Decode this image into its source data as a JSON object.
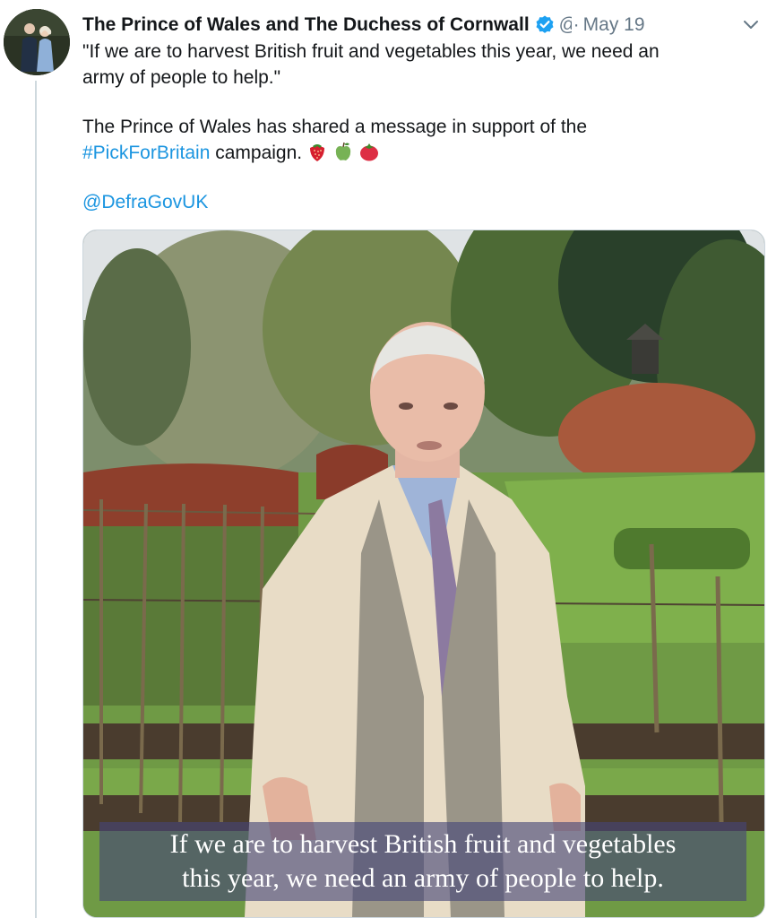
{
  "tweet": {
    "author": {
      "name": "The Prince of Wales and The Duchess of Cornwall",
      "verified": true,
      "handle": "@",
      "avatar_icon": "profile-photo"
    },
    "separator": "·",
    "date": "May 19",
    "menu_icon": "chevron-down-icon",
    "text": {
      "quote_line1": "\"If we are to harvest British fruit and vegetables this year, we need an",
      "quote_line2": "army of people to help.\"",
      "message_line1": "The Prince of Wales has shared a message in support of the",
      "hashtag": "#PickForBritain",
      "message_after_hashtag": " campaign.",
      "emojis": [
        "strawberry",
        "green-apple",
        "tomato"
      ],
      "mention": "@DefraGovUK"
    },
    "media": {
      "type": "video-still",
      "subtitle_line1": "If we are to harvest British fruit and vegetables",
      "subtitle_line2": "this year, we need an army of people to help."
    }
  },
  "colors": {
    "link": "#1b95e0",
    "verified": "#1da1f2",
    "secondary_text": "#657786",
    "thread_line": "#cfd9de"
  }
}
